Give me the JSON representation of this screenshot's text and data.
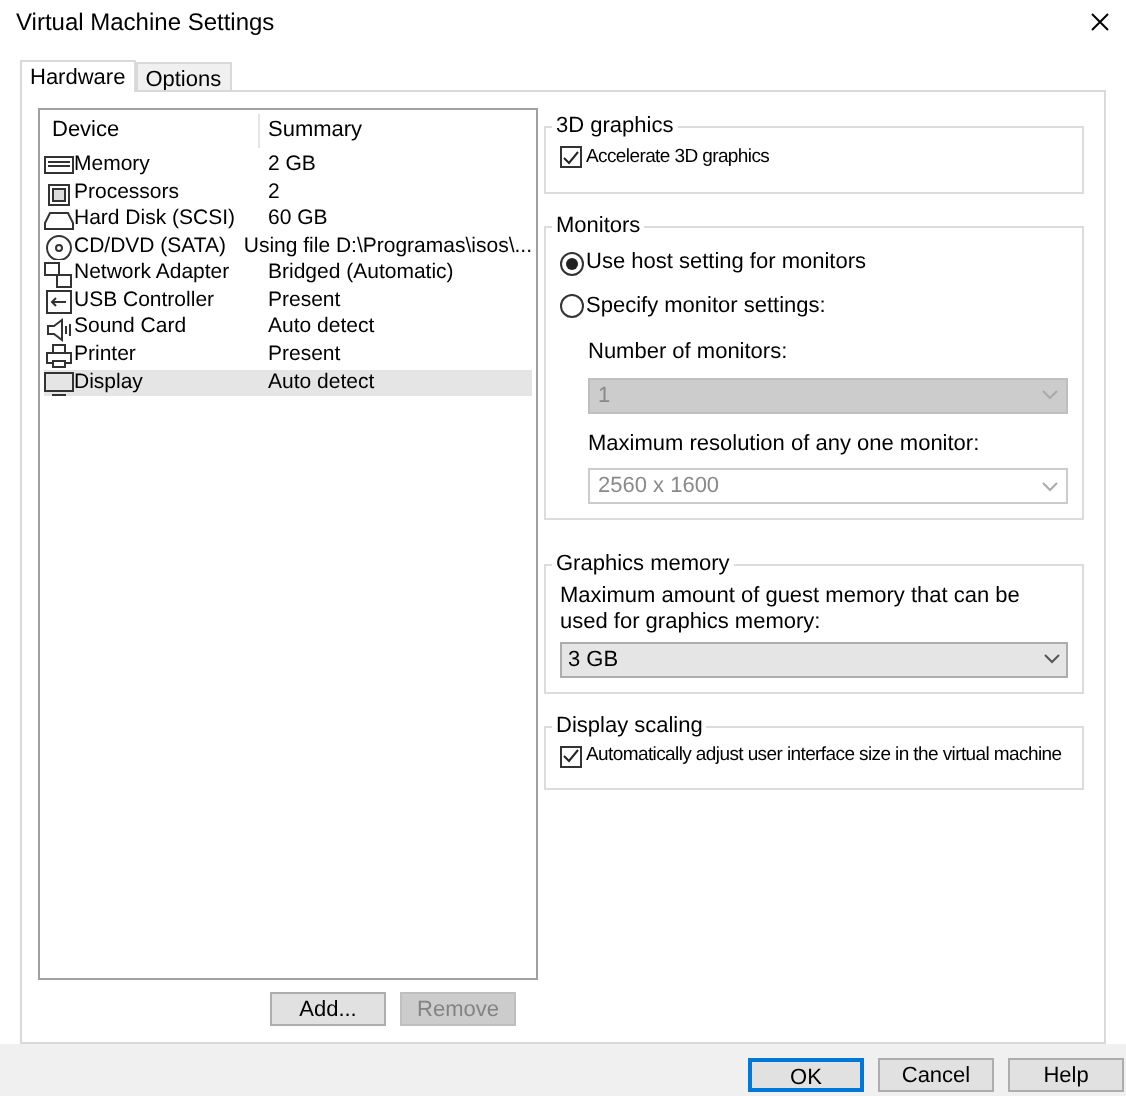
{
  "window": {
    "title": "Virtual Machine Settings"
  },
  "tabs": [
    {
      "label": "Hardware",
      "selected": true
    },
    {
      "label": "Options",
      "selected": false
    }
  ],
  "devices": {
    "columns": [
      "Device",
      "Summary"
    ],
    "rows": [
      {
        "device": "Memory",
        "summary": "2 GB",
        "selected": false
      },
      {
        "device": "Processors",
        "summary": "2",
        "selected": false
      },
      {
        "device": "Hard Disk (SCSI)",
        "summary": "60 GB",
        "selected": false
      },
      {
        "device": "CD/DVD (SATA)",
        "summary": "Using file D:\\Programas\\isos\\...",
        "selected": false
      },
      {
        "device": "Network Adapter",
        "summary": "Bridged (Automatic)",
        "selected": false
      },
      {
        "device": "USB Controller",
        "summary": "Present",
        "selected": false
      },
      {
        "device": "Sound Card",
        "summary": "Auto detect",
        "selected": false
      },
      {
        "device": "Printer",
        "summary": "Present",
        "selected": false
      },
      {
        "device": "Display",
        "summary": "Auto detect",
        "selected": true
      }
    ]
  },
  "list_buttons": [
    {
      "label": "Add...",
      "disabled": false
    },
    {
      "label": "Remove",
      "disabled": true
    }
  ],
  "graphics_3d": {
    "title": "3D graphics",
    "checkbox": {
      "label": "Accelerate 3D graphics",
      "checked": true
    }
  },
  "monitors": {
    "title": "Monitors",
    "options": [
      {
        "label": "Use host setting for monitors",
        "selected": true
      },
      {
        "label": "Specify monitor settings:",
        "selected": false
      }
    ],
    "fields": [
      {
        "label": "Number of monitors:",
        "value": "1",
        "disabled": true
      },
      {
        "label": "Maximum resolution of any one monitor:",
        "value": "2560 x 1600",
        "disabled": true
      }
    ]
  },
  "graphics_memory": {
    "title": "Graphics memory",
    "description": "Maximum amount of guest memory that can be used for graphics memory:",
    "value": "3 GB"
  },
  "display_scaling": {
    "title": "Display scaling",
    "checkbox": {
      "label": "Automatically adjust user interface size in the virtual machine",
      "checked": true
    }
  },
  "footer_buttons": [
    {
      "label": "OK",
      "default": true
    },
    {
      "label": "Cancel",
      "default": false
    },
    {
      "label": "Help",
      "default": false
    }
  ]
}
